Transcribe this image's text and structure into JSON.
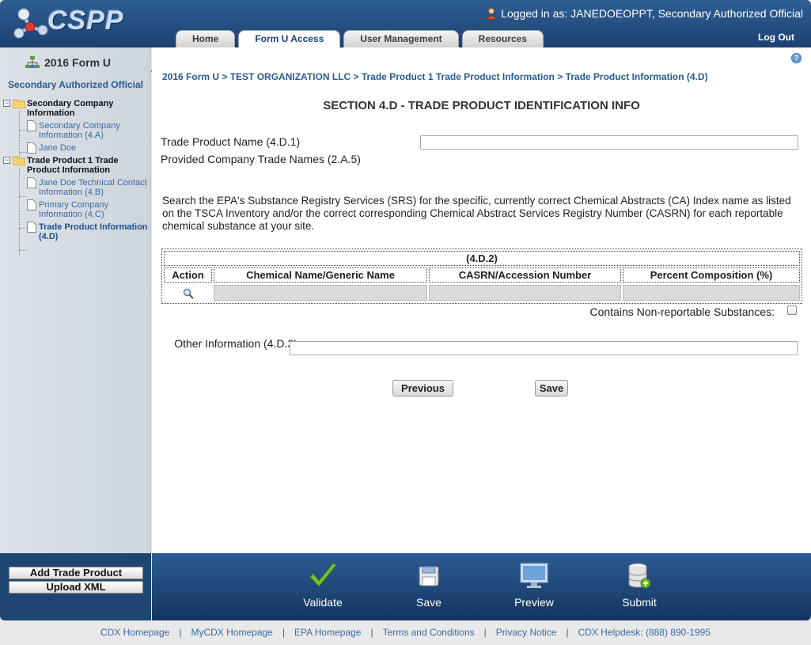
{
  "header": {
    "logo_text": "CSPP",
    "logged_in_text": "Logged in as: JANEDOEOPPT, Secondary Authorized Official",
    "logout_label": "Log Out",
    "tabs": [
      {
        "label": "Home",
        "active": false
      },
      {
        "label": "Form U Access",
        "active": true
      },
      {
        "label": "User Management",
        "active": false
      },
      {
        "label": "Resources",
        "active": false
      }
    ]
  },
  "sidebar": {
    "form_title": "2016 Form U",
    "role": "Secondary Authorized Official",
    "tree": [
      {
        "type": "folder",
        "label": "Secondary Company Information"
      },
      {
        "type": "leaf",
        "label": "Secondary Company Information (4.A)"
      },
      {
        "type": "leaf",
        "label": "Jane Doe"
      },
      {
        "type": "folder",
        "label": "Trade Product 1 Trade Product Information"
      },
      {
        "type": "leaf",
        "label": "Jane Doe Technical Contact Information (4.B)"
      },
      {
        "type": "leaf",
        "label": "Primary Company Information (4.C)"
      },
      {
        "type": "leaf",
        "label": "Trade Product Information (4.D)",
        "current": true
      }
    ],
    "buttons": {
      "add_trade_product": "Add Trade Product",
      "upload_xml": "Upload XML"
    }
  },
  "main": {
    "breadcrumb": [
      "2016 Form U",
      "TEST ORGANIZATION LLC",
      "Trade Product 1 Trade Product Information",
      "Trade Product Information (4.D)"
    ],
    "breadcrumb_sep": " > ",
    "section_title": "SECTION 4.D - TRADE PRODUCT IDENTIFICATION INFO",
    "trade_product_name_label": "Trade Product Name (4.D.1)",
    "trade_product_name_value": "",
    "provided_trade_names_label": "Provided Company Trade Names (2.A.5)",
    "search_instructions": "Search the EPA's Substance Registry Services (SRS) for the specific, currently correct Chemical Abstracts (CA) Index name as listed on the TSCA Inventory and/or the correct corresponding Chemical Abstract Services Registry Number (CASRN) for each reportable chemical substance at your site.",
    "table": {
      "caption": "(4.D.2)",
      "columns": [
        "Action",
        "Chemical Name/Generic Name",
        "CASRN/Accession Number",
        "Percent Composition (%)"
      ],
      "rows": [
        {
          "chemical_name": "",
          "casrn": "",
          "percent": ""
        }
      ]
    },
    "non_reportable_label": "Contains Non-reportable Substances:",
    "non_reportable_checked": false,
    "other_info_label": "Other Information (4.D.3)",
    "other_info_value": "",
    "buttons": {
      "previous": "Previous",
      "save": "Save"
    }
  },
  "action_bar": {
    "validate": "Validate",
    "save": "Save",
    "preview": "Preview",
    "submit": "Submit"
  },
  "footer": {
    "links": [
      "CDX Homepage",
      "MyCDX Homepage",
      "EPA Homepage",
      "Terms and Conditions",
      "Privacy Notice",
      "CDX Helpdesk: (888) 890-1995"
    ],
    "separator": "|"
  },
  "colors": {
    "header_blue": "#1c4170",
    "link_blue": "#2a5b94",
    "validate_green": "#6fb42c"
  },
  "icons": {
    "logo": "cspp-molecule-logo",
    "user": "user-icon",
    "help": "help-icon",
    "search": "magnifier-icon",
    "validate": "checkmark-icon",
    "save": "floppy-disk-icon",
    "preview": "monitor-icon",
    "submit": "database-add-icon"
  }
}
